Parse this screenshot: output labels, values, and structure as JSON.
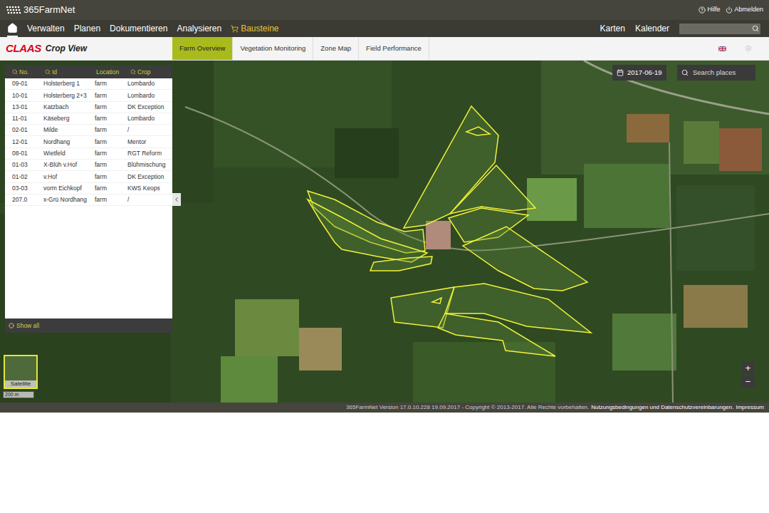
{
  "topbar": {
    "logo": "365FarmNet",
    "links": [
      {
        "label": "Hilfe",
        "kind": "help"
      },
      {
        "label": "Abmelden",
        "kind": "logout"
      }
    ]
  },
  "nav": {
    "items": [
      {
        "label": "Verwalten",
        "selected": false
      },
      {
        "label": "Planen",
        "selected": false
      },
      {
        "label": "Dokumentieren",
        "selected": false
      },
      {
        "label": "Analysieren",
        "selected": false
      },
      {
        "label": "Bausteine",
        "selected": true
      }
    ],
    "right": [
      "Karten",
      "Kalender"
    ],
    "search": {
      "placeholder": ""
    }
  },
  "app": {
    "brand": "CLAAS",
    "title": "Crop View",
    "tabs": [
      {
        "label": "Farm Overview",
        "selected": true
      },
      {
        "label": "Vegetation Monitoring",
        "selected": false
      },
      {
        "label": "Zone Map",
        "selected": false
      },
      {
        "label": "Field Performance",
        "selected": false
      }
    ]
  },
  "table": {
    "columns": [
      {
        "label": "No.",
        "searchable": true
      },
      {
        "label": "Id",
        "searchable": true
      },
      {
        "label": "Location",
        "searchable": false
      },
      {
        "label": "Crop",
        "searchable": true
      }
    ],
    "rows": [
      {
        "no": "09-01",
        "id": "Holsterberg 1",
        "location": "farm",
        "crop": "Lombardo"
      },
      {
        "no": "10-01",
        "id": "Holsterberg 2+3",
        "location": "farm",
        "crop": "Lombardo"
      },
      {
        "no": "13-01",
        "id": "Katzbach",
        "location": "farm",
        "crop": "DK Exception"
      },
      {
        "no": "11-01",
        "id": "Käseberg",
        "location": "farm",
        "crop": "Lombardo"
      },
      {
        "no": "02-01",
        "id": "Milde",
        "location": "farm",
        "crop": "/"
      },
      {
        "no": "12-01",
        "id": "Nordhang",
        "location": "farm",
        "crop": "Mentor"
      },
      {
        "no": "08-01",
        "id": "Wietfeld",
        "location": "farm",
        "crop": "RGT Reform"
      },
      {
        "no": "01-03",
        "id": "X-Blüh v.Hof",
        "location": "farm",
        "crop": "Blühmischung"
      },
      {
        "no": "01-02",
        "id": "v.Hof",
        "location": "farm",
        "crop": "DK Exception"
      },
      {
        "no": "03-03",
        "id": "vorm Eichkopf",
        "location": "farm",
        "crop": "KWS Keops"
      },
      {
        "no": "207.0",
        "id": "x-Grü Nordhang",
        "location": "farm",
        "crop": "/"
      }
    ],
    "footer": "Show all"
  },
  "map": {
    "date": "2017-06-19",
    "search": {
      "placeholder": "Search places"
    },
    "layer": "Satellite",
    "scale": "200 m",
    "zoom": [
      "+",
      "−"
    ]
  },
  "footer": {
    "text": "365FarmNet Version 17.0.10.228 19.09.2017 - Copyright © 2013-2017. Alle Rechte vorbehalten.",
    "links": [
      "Nutzungsbedingungen und Datenschutzvereinbarungen.",
      "Impressum"
    ]
  }
}
